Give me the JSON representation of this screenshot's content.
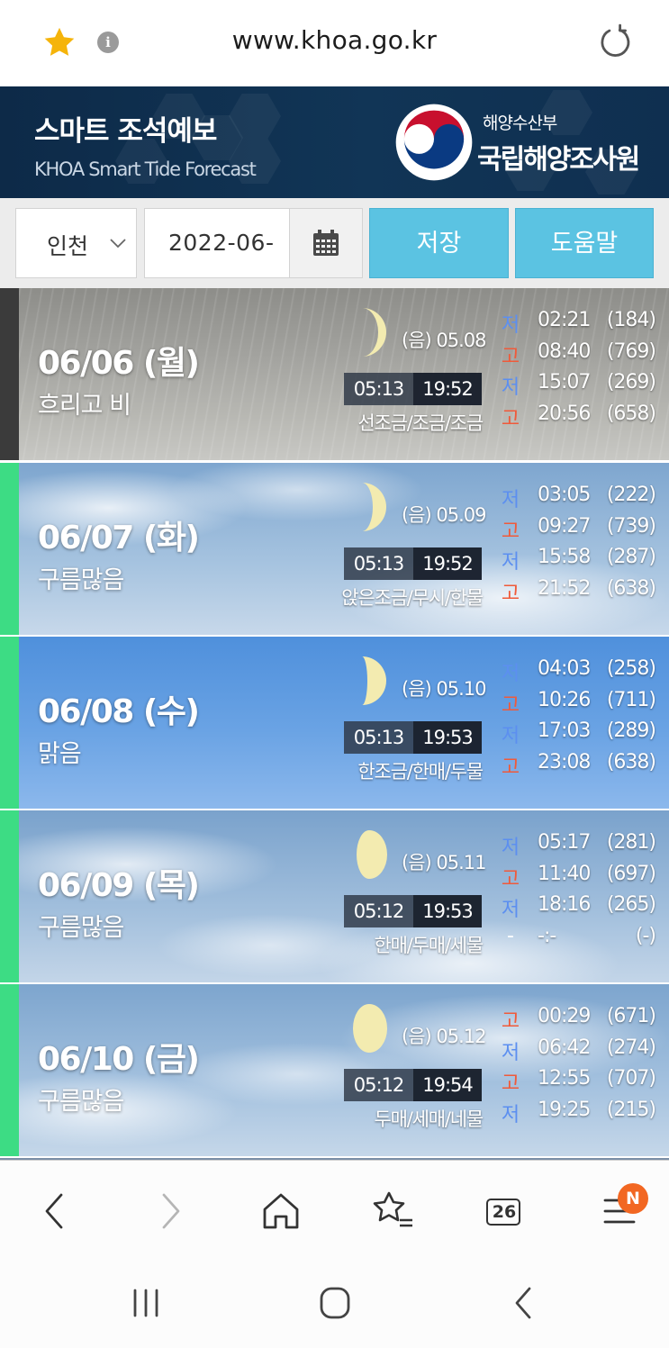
{
  "browser": {
    "url": "www.khoa.go.kr",
    "bookmark_icon": "star-icon",
    "info_icon": "info-icon",
    "reload_icon": "reload-icon",
    "info_glyph": "i"
  },
  "header": {
    "title": "스마트 조석예보",
    "subtitle": "KHOA Smart Tide Forecast",
    "ministry": "해양수산부",
    "agency": "국립해양조사원"
  },
  "controls": {
    "region": "인천",
    "date": "2022-06-",
    "save_label": "저장",
    "help_label": "도움말"
  },
  "days": [
    {
      "date": "06/06 (월)",
      "weather": "흐리고 비",
      "lunar": "(음) 05.08",
      "sunrise": "05:13",
      "sunset": "19:52",
      "tide_name": "선조금/조금/조금",
      "tides": [
        {
          "type": "저",
          "time": "02:21",
          "level": "(184)"
        },
        {
          "type": "고",
          "time": "08:40",
          "level": "(769)"
        },
        {
          "type": "저",
          "time": "15:07",
          "level": "(269)"
        },
        {
          "type": "고",
          "time": "20:56",
          "level": "(658)"
        }
      ]
    },
    {
      "date": "06/07 (화)",
      "weather": "구름많음",
      "lunar": "(음) 05.09",
      "sunrise": "05:13",
      "sunset": "19:52",
      "tide_name": "앉은조금/무시/한물",
      "tides": [
        {
          "type": "저",
          "time": "03:05",
          "level": "(222)"
        },
        {
          "type": "고",
          "time": "09:27",
          "level": "(739)"
        },
        {
          "type": "저",
          "time": "15:58",
          "level": "(287)"
        },
        {
          "type": "고",
          "time": "21:52",
          "level": "(638)"
        }
      ]
    },
    {
      "date": "06/08 (수)",
      "weather": "맑음",
      "lunar": "(음) 05.10",
      "sunrise": "05:13",
      "sunset": "19:53",
      "tide_name": "한조금/한매/두물",
      "tides": [
        {
          "type": "저",
          "time": "04:03",
          "level": "(258)"
        },
        {
          "type": "고",
          "time": "10:26",
          "level": "(711)"
        },
        {
          "type": "저",
          "time": "17:03",
          "level": "(289)"
        },
        {
          "type": "고",
          "time": "23:08",
          "level": "(638)"
        }
      ]
    },
    {
      "date": "06/09 (목)",
      "weather": "구름많음",
      "lunar": "(음) 05.11",
      "sunrise": "05:12",
      "sunset": "19:53",
      "tide_name": "한매/두매/세물",
      "tides": [
        {
          "type": "저",
          "time": "05:17",
          "level": "(281)"
        },
        {
          "type": "고",
          "time": "11:40",
          "level": "(697)"
        },
        {
          "type": "저",
          "time": "18:16",
          "level": "(265)"
        },
        {
          "type": "-",
          "time": "-:-",
          "level": "(-)"
        }
      ]
    },
    {
      "date": "06/10 (금)",
      "weather": "구름많음",
      "lunar": "(음) 05.12",
      "sunrise": "05:12",
      "sunset": "19:54",
      "tide_name": "두매/세매/네물",
      "tides": [
        {
          "type": "고",
          "time": "00:29",
          "level": "(671)"
        },
        {
          "type": "저",
          "time": "06:42",
          "level": "(274)"
        },
        {
          "type": "고",
          "time": "12:55",
          "level": "(707)"
        },
        {
          "type": "저",
          "time": "19:25",
          "level": "(215)"
        }
      ]
    }
  ],
  "toolbar": {
    "tabs_count": "26",
    "menu_badge": "N"
  },
  "colors": {
    "accent_today": "#3b3b3b",
    "accent_future": "#3ddc84",
    "button": "#5bc3e2",
    "low_tide": "#5c8ff0",
    "high_tide": "#f05a3a"
  }
}
